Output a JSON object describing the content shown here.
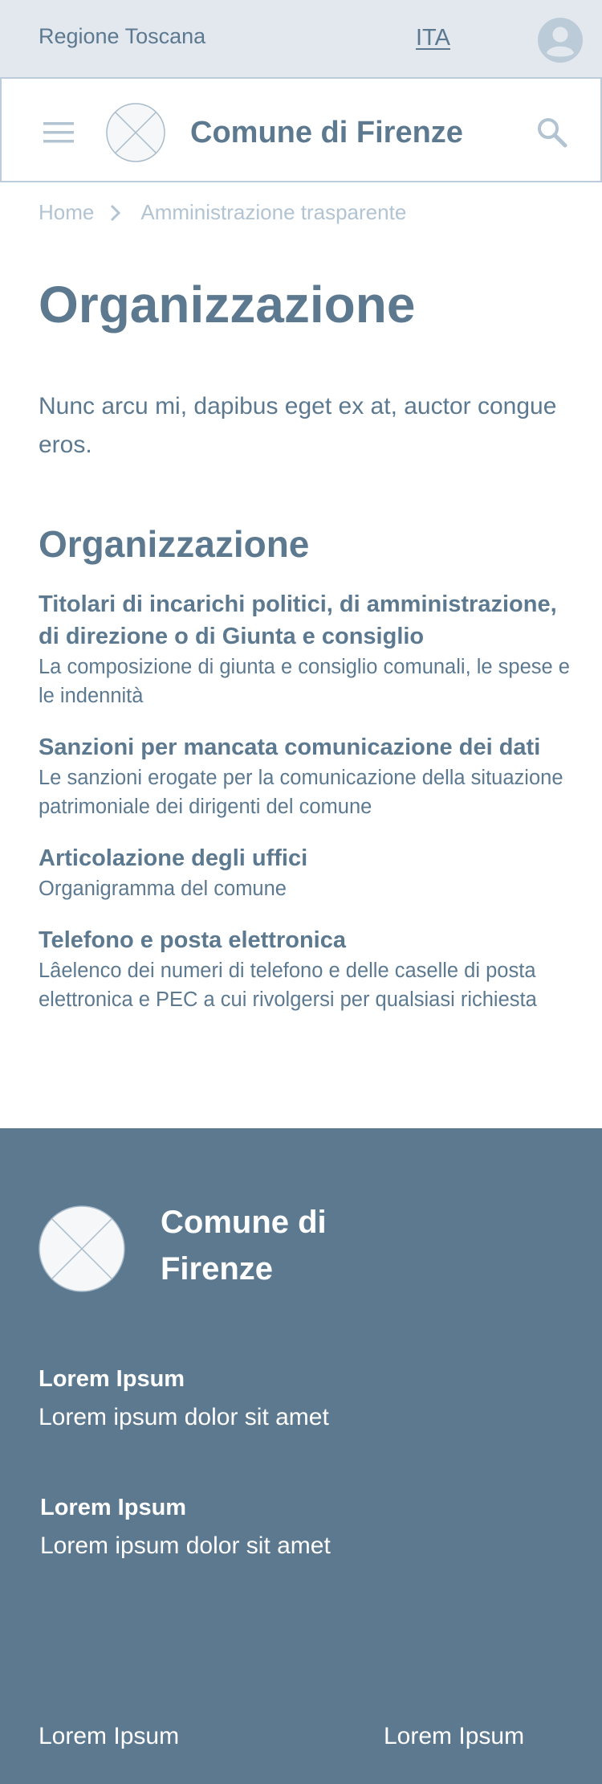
{
  "topbar": {
    "region": "Regione Toscana",
    "language": "ITA",
    "icons": {
      "avatar": "user-avatar-icon"
    }
  },
  "header": {
    "title": "Comune di Firenze",
    "icons": {
      "menu": "hamburger-menu-icon",
      "logo": "logo-placeholder-icon",
      "search": "search-icon"
    }
  },
  "breadcrumb": {
    "items": [
      "Home",
      "Amministrazione trasparente"
    ],
    "separator_icon": "chevron-right-icon"
  },
  "main": {
    "title": "Organizzazione",
    "intro": "Nunc arcu mi, dapibus eget ex at, auctor congue eros.",
    "section_title": "Organizzazione",
    "items": [
      {
        "title": "Titolari di incarichi politici, di amministrazione, di direzione o di Giunta e consiglio",
        "description": "La composizione di giunta e consiglio comunali, le spese e le indennità"
      },
      {
        "title": "Sanzioni per mancata comunicazione dei dati",
        "description": "Le sanzioni erogate per la comunicazione della situazione patrimoniale dei dirigenti del comune"
      },
      {
        "title": "Articolazione degli uffici",
        "description": "Organigramma del comune"
      },
      {
        "title": "Telefono e posta elettronica",
        "description": "Lâelenco dei numeri di telefono e delle caselle di posta elettronica e PEC a cui rivolgersi per qualsiasi richiesta"
      }
    ]
  },
  "footer": {
    "title": "Comune di Firenze",
    "logo_icon": "logo-placeholder-icon",
    "blocks": [
      {
        "heading": "Lorem Ipsum",
        "text": "Lorem ipsum dolor sit amet"
      },
      {
        "heading": "Lorem Ipsum",
        "text": "Lorem ipsum dolor sit amet"
      }
    ],
    "links": [
      "Lorem Ipsum",
      "Lorem Ipsum"
    ]
  },
  "colors": {
    "primary": "#5c7990",
    "topbar_bg": "#e3e8ef",
    "light_accent": "#b2c3d2",
    "header_border": "#bcccda",
    "placeholder_fill": "#f6f7f8"
  }
}
